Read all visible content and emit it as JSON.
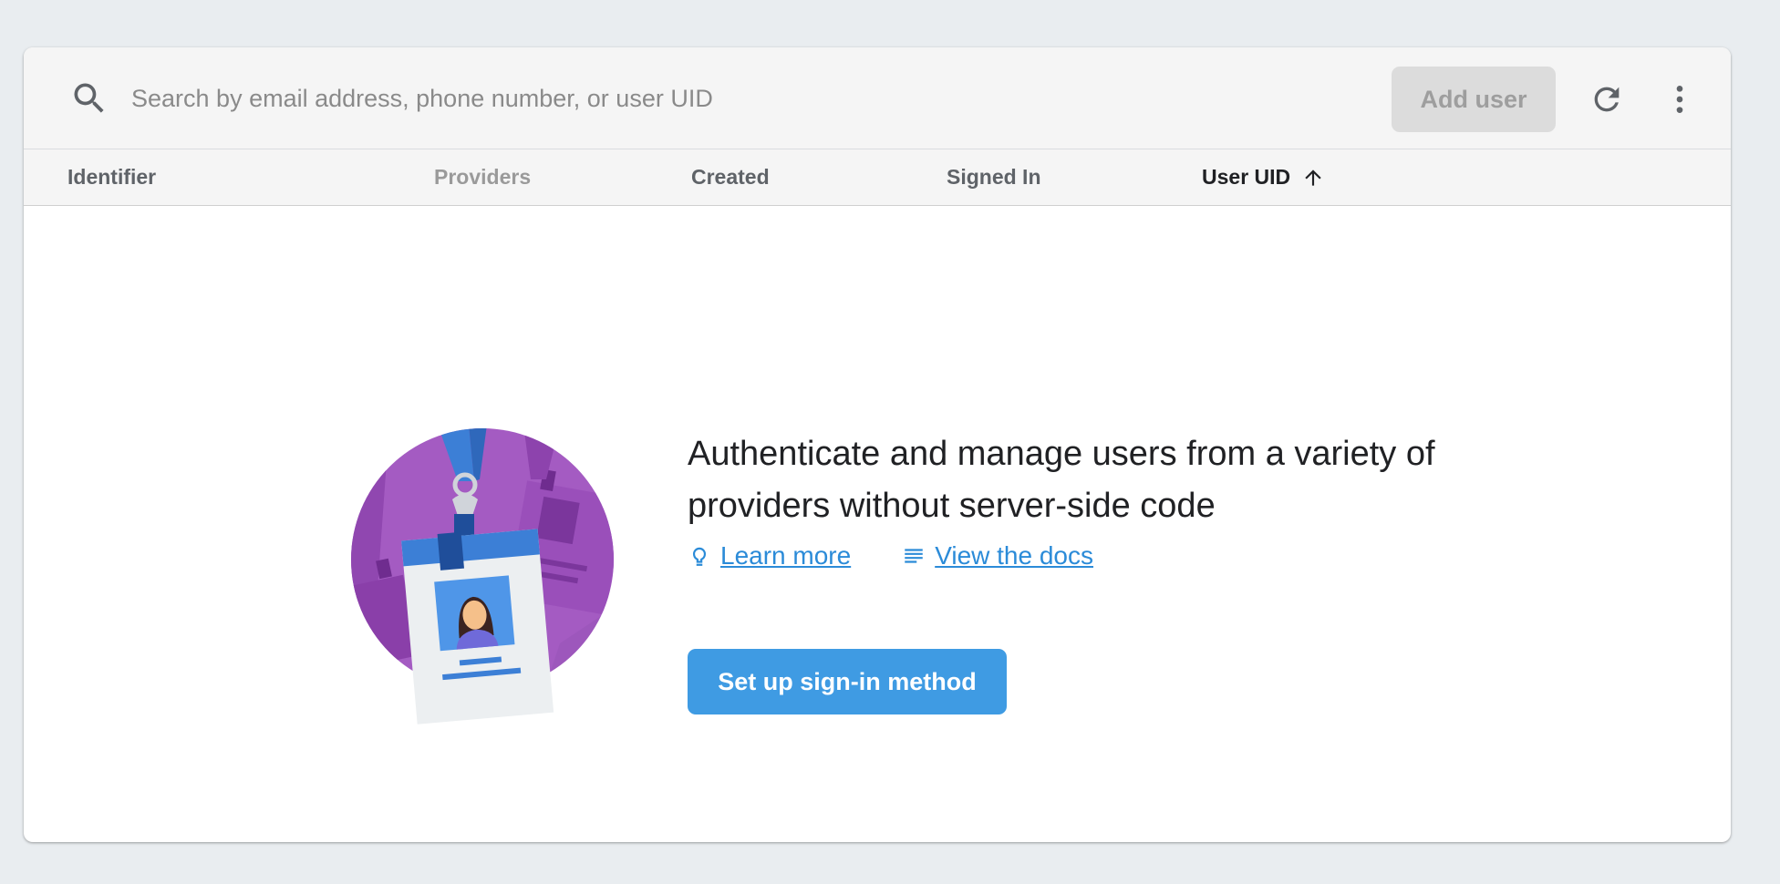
{
  "toolbar": {
    "search_placeholder": "Search by email address, phone number, or user UID",
    "search_value": "",
    "add_user_label": "Add user",
    "icons": [
      "search-icon",
      "refresh-icon",
      "more-vert-icon"
    ]
  },
  "table": {
    "columns": [
      {
        "label": "Identifier"
      },
      {
        "label": "Providers"
      },
      {
        "label": "Created"
      },
      {
        "label": "Signed In"
      },
      {
        "label": "User UID",
        "sort": "ascending"
      }
    ]
  },
  "empty_state": {
    "headline": "Authenticate and manage users from a variety of providers without server-side code",
    "learn_more_label": "Learn more",
    "view_docs_label": "View the docs",
    "cta_label": "Set up sign-in method",
    "illustration": "id-badge-illustration"
  },
  "colors": {
    "background": "#e9edf0",
    "toolbar": "#f5f5f5",
    "accent": "#3f9be3",
    "link": "#2b8bd8",
    "illustration_purple": "#a45bc2"
  }
}
